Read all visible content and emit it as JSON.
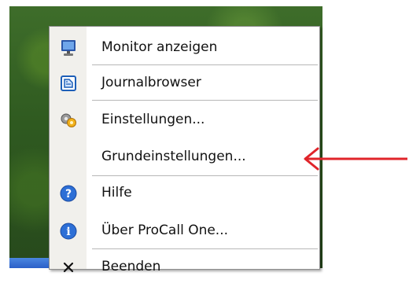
{
  "menu": {
    "items": [
      {
        "label": "Monitor anzeigen",
        "icon": "monitor-icon"
      },
      {
        "label": "Journalbrowser",
        "icon": "journal-icon"
      },
      {
        "label": "Einstellungen...",
        "icon": "settings-gear-icon"
      },
      {
        "label": "Grundeinstellungen...",
        "icon": ""
      },
      {
        "label": "Hilfe",
        "icon": "help-icon"
      },
      {
        "label": "Über ProCall One...",
        "icon": "info-icon"
      },
      {
        "label": "Beenden",
        "icon": "close-icon"
      }
    ]
  },
  "colors": {
    "arrow": "#e0242a",
    "menu_icon_column": "#f1f0ec"
  }
}
